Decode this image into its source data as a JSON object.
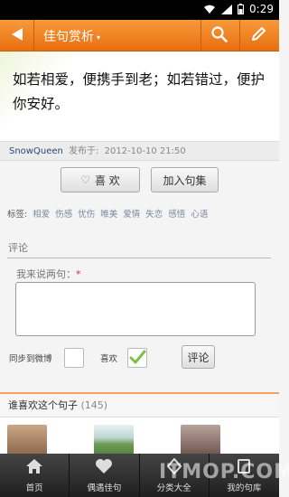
{
  "status_bar": {
    "time": "0:29"
  },
  "header": {
    "back_icon": "arrow-left-icon",
    "title": "佳句赏析",
    "caret": "▾",
    "search_icon": "search-icon",
    "edit_icon": "pencil-icon"
  },
  "quote": {
    "text": "如若相爱，便携手到老；如若错过，便护你安好。"
  },
  "meta": {
    "author": "SnowQueen",
    "published_label": "发布于:",
    "date": "2012-10-10 21:50"
  },
  "actions": {
    "like_label": "喜 欢",
    "collect_label": "加入句集"
  },
  "tags": {
    "label": "标签:",
    "items": [
      "相爱",
      "伤感",
      "忧伤",
      "唯美",
      "爱情",
      "失恋",
      "感悟",
      "心语"
    ]
  },
  "comment": {
    "section_title": "评论",
    "say_label": "我来说两句：",
    "required_mark": "*",
    "input_value": "",
    "sync_label": "同步到微博",
    "sync_checked": false,
    "like_label": "喜欢",
    "like_checked": true,
    "submit_label": "评论"
  },
  "likes": {
    "title": "谁喜欢这个句子",
    "count": "(145)"
  },
  "bottom_nav": [
    {
      "label": "首页",
      "icon": "home-icon"
    },
    {
      "label": "偶遇佳句",
      "icon": "heart-icon"
    },
    {
      "label": "分类大全",
      "icon": "categories-icon"
    },
    {
      "label": "我的句库",
      "icon": "library-icon"
    }
  ],
  "watermark": "ITMOP.COM",
  "colors": {
    "accent": "#e8791c",
    "header_top": "#f79a3a",
    "checkmark": "#7cc242"
  }
}
